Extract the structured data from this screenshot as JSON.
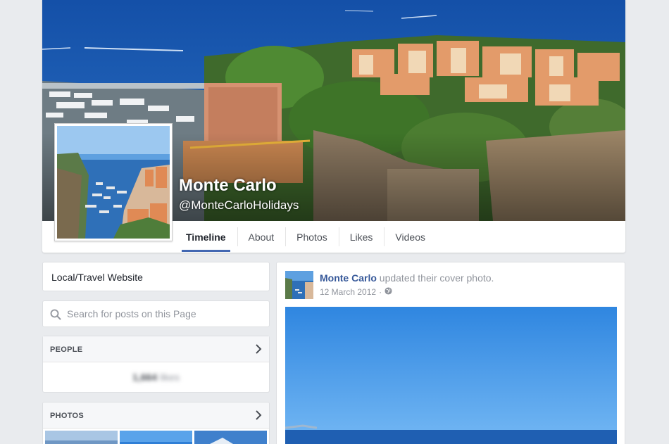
{
  "page": {
    "name": "Monte Carlo",
    "handle": "@MonteCarloHolidays"
  },
  "tabs": [
    {
      "label": "Timeline",
      "active": true
    },
    {
      "label": "About",
      "active": false
    },
    {
      "label": "Photos",
      "active": false
    },
    {
      "label": "Likes",
      "active": false
    },
    {
      "label": "Videos",
      "active": false
    }
  ],
  "sidebar": {
    "category": "Local/Travel Website",
    "search_placeholder": "Search for posts on this Page",
    "people": {
      "heading": "PEOPLE",
      "likes_count": "1,664",
      "likes_label": "likes"
    },
    "photos": {
      "heading": "PHOTOS"
    }
  },
  "post": {
    "author": "Monte Carlo",
    "action": "updated their cover photo.",
    "date": "12 March 2012",
    "separator": "·",
    "audience_icon": "globe-icon"
  },
  "colors": {
    "link_blue": "#365899",
    "active_tab_underline": "#4267b2",
    "page_background": "#e9ebee",
    "sea": "#1e5fb0",
    "sky": "#4a9be8"
  }
}
